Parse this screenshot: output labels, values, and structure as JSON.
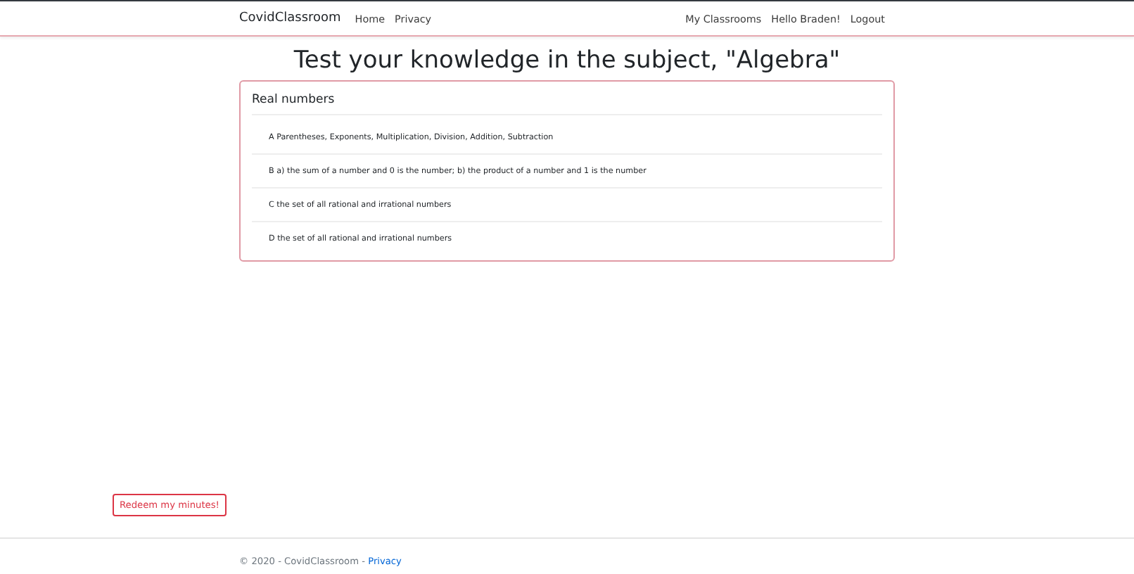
{
  "navbar": {
    "brand": "CovidClassroom",
    "left_links": [
      "Home",
      "Privacy"
    ],
    "right_links": [
      "My Classrooms",
      "Hello Braden!",
      "Logout"
    ]
  },
  "heading": "Test your knowledge in the subject, \"Algebra\"",
  "question": {
    "title": "Real numbers",
    "answers": [
      {
        "text": "A Parentheses, Exponents, Multiplication, Division, Addition, Subtraction"
      },
      {
        "text": "B a) the sum of a number and 0 is the number; b) the product of a number and 1 is the number"
      },
      {
        "text": "C the set of all rational and irrational numbers"
      },
      {
        "text": "D the set of all rational and irrational numbers"
      }
    ]
  },
  "redeem_button": "Redeem my minutes!",
  "footer": {
    "text": "© 2020 - CovidClassroom - ",
    "link": "Privacy"
  }
}
